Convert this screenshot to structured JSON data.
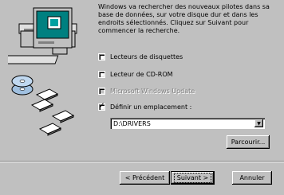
{
  "description": "Windows va rechercher des nouveaux pilotes dans sa base de données, sur votre disque dur et dans les endroits sélectionnés. Cliquez sur Suivant pour commencer la recherche.",
  "options": [
    {
      "label": "Lecteurs de disquettes",
      "checked": false,
      "disabled": false
    },
    {
      "label": "Lecteur de CD-ROM",
      "checked": false,
      "disabled": false
    },
    {
      "label": "Microsoft Windows Update",
      "checked": false,
      "disabled": true
    },
    {
      "label": "Définir un emplacement :",
      "checked": true,
      "disabled": false
    }
  ],
  "location": {
    "value": "D:\\DRIVERS"
  },
  "buttons": {
    "browse": "Parcourir...",
    "back": "< Précédent",
    "next": "Suivant >",
    "cancel": "Annuler"
  }
}
